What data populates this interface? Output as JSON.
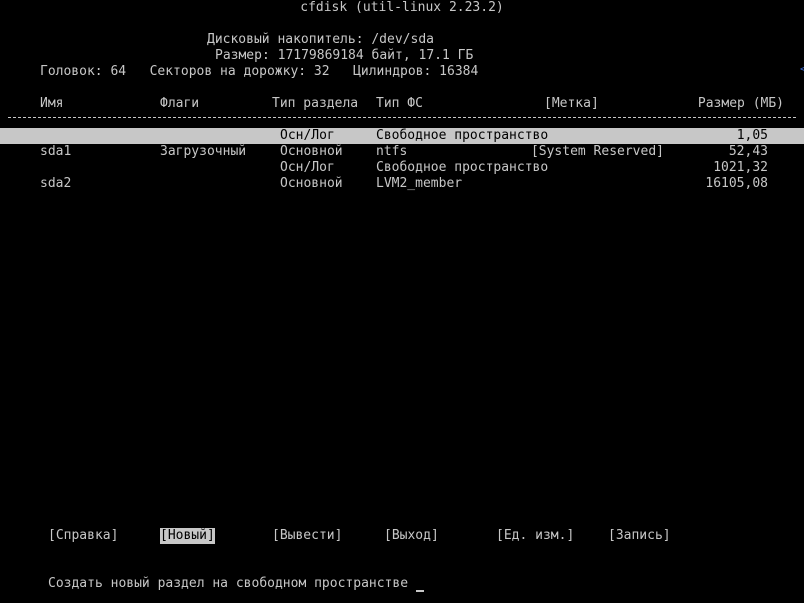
{
  "header": {
    "title": "cfdisk (util-linux 2.23.2)",
    "disk_line": "Дисковый накопитель: /dev/sda",
    "size_line": "Размер: 17179869184 байт, 17.1 ГБ",
    "geometry_line": "Головок: 64   Секторов на дорожку: 32   Цилиндров: 16384"
  },
  "table": {
    "columns": {
      "name": "Имя",
      "flags": "Флаги",
      "part_type": "Тип раздела",
      "fs_type": "Тип ФС",
      "label": "[Метка]",
      "size": "Размер (МБ)"
    },
    "rows": [
      {
        "name": "",
        "flags": "",
        "part_type": "Осн/Лог",
        "fs_type": "Свободное пространство",
        "label": "",
        "size": "1,05",
        "selected": true
      },
      {
        "name": "sda1",
        "flags": "Загрузочный",
        "part_type": "Основной",
        "fs_type": "ntfs",
        "label": "[System Reserved]",
        "size": "52,43",
        "selected": false
      },
      {
        "name": "",
        "flags": "",
        "part_type": "Осн/Лог",
        "fs_type": "Свободное пространство",
        "label": "",
        "size": "1021,32",
        "selected": false
      },
      {
        "name": "sda2",
        "flags": "",
        "part_type": "Основной",
        "fs_type": "LVM2_member",
        "label": "",
        "size": "16105,08",
        "selected": false
      }
    ]
  },
  "menu": {
    "help": "[Справка]",
    "new": "[Новый]",
    "print": "[Вывести]",
    "quit": "[Выход]",
    "units": "[Ед. изм.]",
    "write": "[Запись]",
    "active": "new"
  },
  "status": {
    "message": "Создать новый раздел на свободном пространстве"
  },
  "colors": {
    "background": "#000000",
    "foreground": "#c7c7c7",
    "highlight": "#c7c7c7"
  }
}
